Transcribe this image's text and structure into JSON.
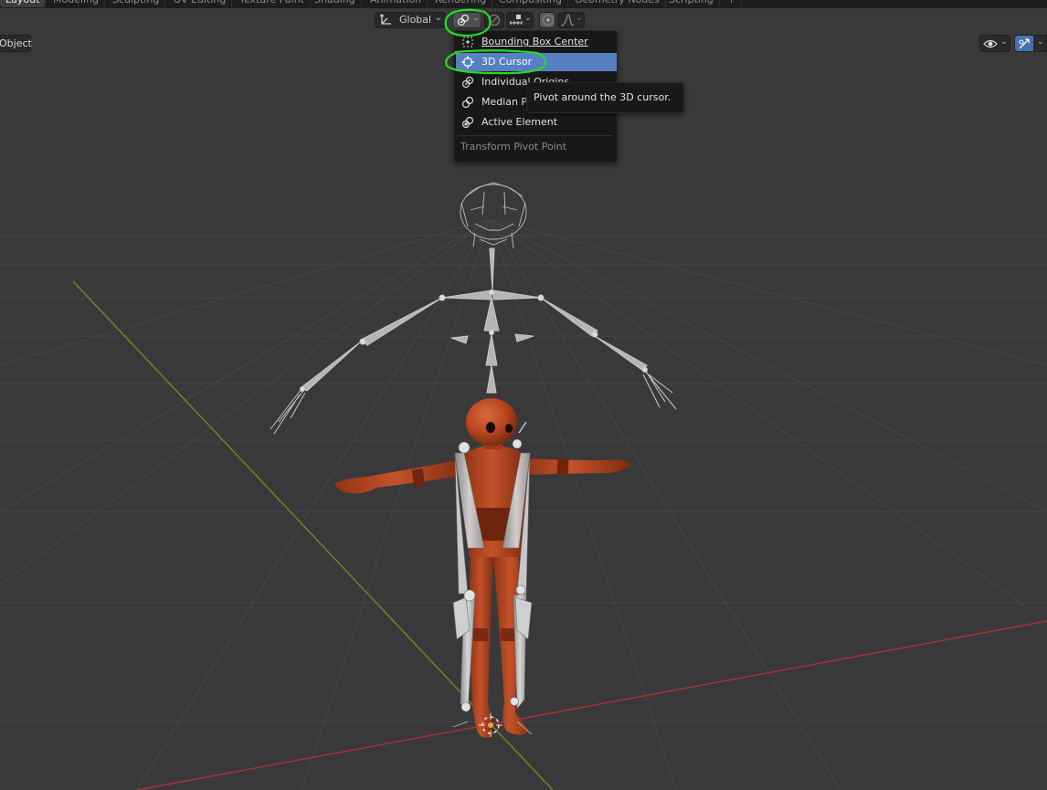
{
  "workspace_tabs": [
    "Layout",
    "Modeling",
    "Sculpting",
    "UV Editing",
    "Texture Paint",
    "Shading",
    "Animation",
    "Rendering",
    "Compositing",
    "Geometry Nodes",
    "Scripting",
    "+"
  ],
  "header": {
    "transform_orientation": "Global",
    "mode_label": "Object"
  },
  "pivot_menu": {
    "items": [
      {
        "label": "Bounding Box Center",
        "icon": "bounding-box-center-icon",
        "selected": false
      },
      {
        "label": "3D Cursor",
        "icon": "3d-cursor-pivot-icon",
        "selected": true
      },
      {
        "label": "Individual Origins",
        "icon": "individual-origins-icon",
        "selected": false
      },
      {
        "label": "Median Point",
        "icon": "median-point-icon",
        "selected": false
      },
      {
        "label": "Active Element",
        "icon": "active-element-icon",
        "selected": false
      }
    ],
    "title": "Transform Pivot Point"
  },
  "tooltip": {
    "text": "Pivot around the 3D cursor."
  },
  "colors": {
    "viewport_bg": "#393939",
    "menu_selected": "#5680c2",
    "annotation": "#22dd22",
    "character_skin": "#b8461f",
    "x_axis": "#b0303b",
    "y_axis": "#6b8e23"
  }
}
